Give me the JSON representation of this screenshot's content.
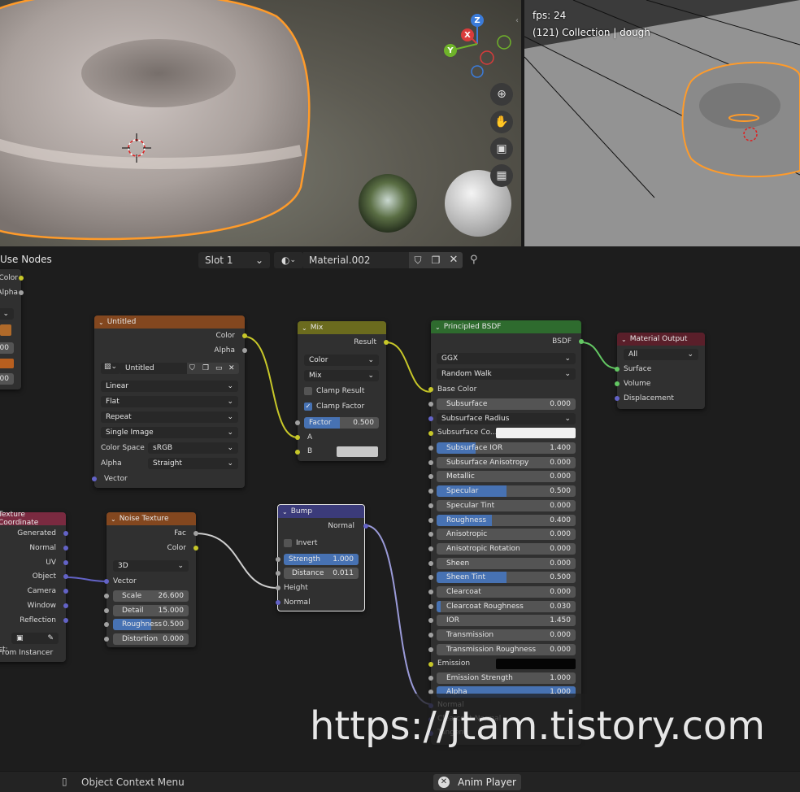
{
  "viewport_right": {
    "fps": "fps: 24",
    "collection": "(121) Collection | dough"
  },
  "gizmo": {
    "z": "Z",
    "x": "X",
    "y": "Y"
  },
  "header": {
    "use_nodes": "Use Nodes",
    "slot": "Slot 1",
    "material": "Material.002"
  },
  "left_partial": {
    "color": "Color",
    "alpha": "Alpha",
    "v1": "00",
    "v2": "00"
  },
  "image_node": {
    "title": "Untitled",
    "out_color": "Color",
    "out_alpha": "Alpha",
    "image_name": "Untitled",
    "interp": "Linear",
    "proj": "Flat",
    "ext": "Repeat",
    "source": "Single Image",
    "colorspace_label": "Color Space",
    "colorspace": "sRGB",
    "alpha_label": "Alpha",
    "alpha": "Straight",
    "vector": "Vector"
  },
  "mix_node": {
    "title": "Mix",
    "result": "Result",
    "type": "Color",
    "blend": "Mix",
    "clamp_result": "Clamp Result",
    "clamp_factor": "Clamp Factor",
    "factor_label": "Factor",
    "factor": "0.500",
    "a": "A",
    "b": "B"
  },
  "bsdf_node": {
    "title": "Principled BSDF",
    "out": "BSDF",
    "dist": "GGX",
    "sss_method": "Random Walk",
    "base_color": "Base Color",
    "subsurface_label": "Subsurface",
    "subsurface": "0.000",
    "subsurface_radius": "Subsurface Radius",
    "subsurface_color": "Subsurface Co...",
    "rows": [
      {
        "label": "Subsurface IOR",
        "value": "1.400",
        "fill": 0.28
      },
      {
        "label": "Subsurface Anisotropy",
        "value": "0.000",
        "fill": 0
      },
      {
        "label": "Metallic",
        "value": "0.000",
        "fill": 0
      },
      {
        "label": "Specular",
        "value": "0.500",
        "fill": 0.5
      },
      {
        "label": "Specular Tint",
        "value": "0.000",
        "fill": 0
      },
      {
        "label": "Roughness",
        "value": "0.400",
        "fill": 0.4
      },
      {
        "label": "Anisotropic",
        "value": "0.000",
        "fill": 0
      },
      {
        "label": "Anisotropic Rotation",
        "value": "0.000",
        "fill": 0
      },
      {
        "label": "Sheen",
        "value": "0.000",
        "fill": 0
      },
      {
        "label": "Sheen Tint",
        "value": "0.500",
        "fill": 0.5
      },
      {
        "label": "Clearcoat",
        "value": "0.000",
        "fill": 0
      },
      {
        "label": "Clearcoat Roughness",
        "value": "0.030",
        "fill": 0.03
      },
      {
        "label": "IOR",
        "value": "1.450",
        "fill": 0
      },
      {
        "label": "Transmission",
        "value": "0.000",
        "fill": 0
      },
      {
        "label": "Transmission Roughness",
        "value": "0.000",
        "fill": 0
      }
    ],
    "emission": "Emission",
    "emission_strength_label": "Emission Strength",
    "emission_strength": "1.000",
    "alpha_label": "Alpha",
    "alpha": "1.000",
    "normal": "Normal",
    "clearcoat_normal": "Clearcoat Normal",
    "tangent": "Tangent"
  },
  "output_node": {
    "title": "Material Output",
    "target": "All",
    "surface": "Surface",
    "volume": "Volume",
    "displacement": "Displacement"
  },
  "texcoord_node": {
    "title": "Texture Coordinate",
    "outputs": [
      "Generated",
      "Normal",
      "UV",
      "Object",
      "Camera",
      "Window",
      "Reflection"
    ],
    "object_label": "ct:",
    "instancer": "From Instancer"
  },
  "noise_node": {
    "title": "Noise Texture",
    "fac": "Fac",
    "color": "Color",
    "dim": "3D",
    "vector": "Vector",
    "rows": [
      {
        "label": "Scale",
        "value": "26.600",
        "fill": 0
      },
      {
        "label": "Detail",
        "value": "15.000",
        "fill": 0
      },
      {
        "label": "Roughness",
        "value": "0.500",
        "fill": 0.5
      },
      {
        "label": "Distortion",
        "value": "0.000",
        "fill": 0
      }
    ]
  },
  "bump_node": {
    "title": "Bump",
    "normal_out": "Normal",
    "invert": "Invert",
    "strength_label": "Strength",
    "strength": "1.000",
    "distance_label": "Distance",
    "distance": "0.011",
    "height": "Height",
    "normal_in": "Normal"
  },
  "bottom": {
    "context_menu": "Object Context Menu",
    "anim_player": "Anim Player"
  },
  "watermark": "https://jtam.tistory.com",
  "colors": {
    "image_header": "#83471f",
    "mix_header": "#6b6b1e",
    "bsdf_header": "#2e6b2e",
    "output_header": "#5a1f2a",
    "texcoord_header": "#7a2a40",
    "noise_header": "#83471f",
    "bump_header": "#3b3b7a",
    "selection_orange": "#ff9b2a"
  }
}
